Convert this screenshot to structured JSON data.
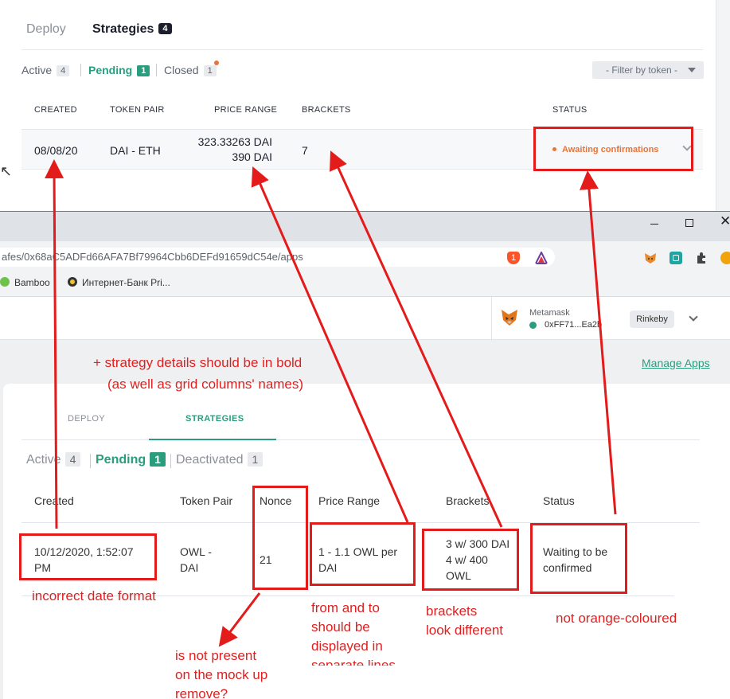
{
  "top": {
    "tabs": [
      {
        "label": "Deploy"
      },
      {
        "label": "Strategies",
        "badge": "4"
      }
    ],
    "filters": [
      {
        "label": "Active",
        "count": "4"
      },
      {
        "label": "Pending",
        "count": "1"
      },
      {
        "label": "Closed",
        "count": "1"
      }
    ],
    "filter_token": "- Filter by token -",
    "columns": [
      "CREATED",
      "TOKEN PAIR",
      "PRICE RANGE",
      "BRACKETS",
      "STATUS"
    ],
    "row": {
      "created": "08/08/20",
      "pair": "DAI - ETH",
      "price_from": "323.33263 DAI",
      "price_to": "390 DAI",
      "brackets": "7",
      "status": "Awaiting confirmations"
    }
  },
  "browser": {
    "url": "afes/0x68aC5ADFd66AFA7Bf79964Cbb6DEFd91659dC54e/apps",
    "extensions": {
      "brave_badge": "1"
    },
    "bookmarks": [
      "Bamboo",
      "Интернет-Банк Pri..."
    ],
    "wallet": {
      "name": "Metamask",
      "address": "0xFF71...Ea2b",
      "network": "Rinkeby"
    },
    "manage_apps": "Manage Apps",
    "tabs": [
      "DEPLOY",
      "STRATEGIES"
    ],
    "filters": [
      {
        "label": "Active",
        "count": "4"
      },
      {
        "label": "Pending",
        "count": "1"
      },
      {
        "label": "Deactivated",
        "count": "1"
      }
    ],
    "columns": [
      "Created",
      "Token Pair",
      "Nonce",
      "Price Range",
      "Brackets",
      "Status"
    ],
    "row": {
      "created_line1": "10/12/2020, 1:52:07",
      "created_line2": "PM",
      "pair_line1": "OWL -",
      "pair_line2": "DAI",
      "nonce": "21",
      "price_line1": "1 - 1.1 OWL per",
      "price_line2": "DAI",
      "brackets_line1": "3 w/ 300 DAI",
      "brackets_line2": "4 w/ 400",
      "brackets_line3": "OWL",
      "status_line1": "Waiting to be",
      "status_line2": "confirmed"
    }
  },
  "annotations": {
    "bold_line1": "+ strategy details should be in bold",
    "bold_line2": "(as well as grid columns' names)",
    "date": "incorrect date format",
    "nonce_line1": "is not present",
    "nonce_line2": "on the mock up",
    "nonce_line3": "remove?",
    "price_line1": "from and to",
    "price_line2": "should be",
    "price_line3": "displayed in",
    "price_line4": "separate lines",
    "brackets_line1": "brackets",
    "brackets_line2": "look different",
    "status": "not orange-coloured"
  },
  "colors": {
    "accent": "#2a9d7e",
    "warning": "#e8733a",
    "annotation": "#e41b1b"
  }
}
